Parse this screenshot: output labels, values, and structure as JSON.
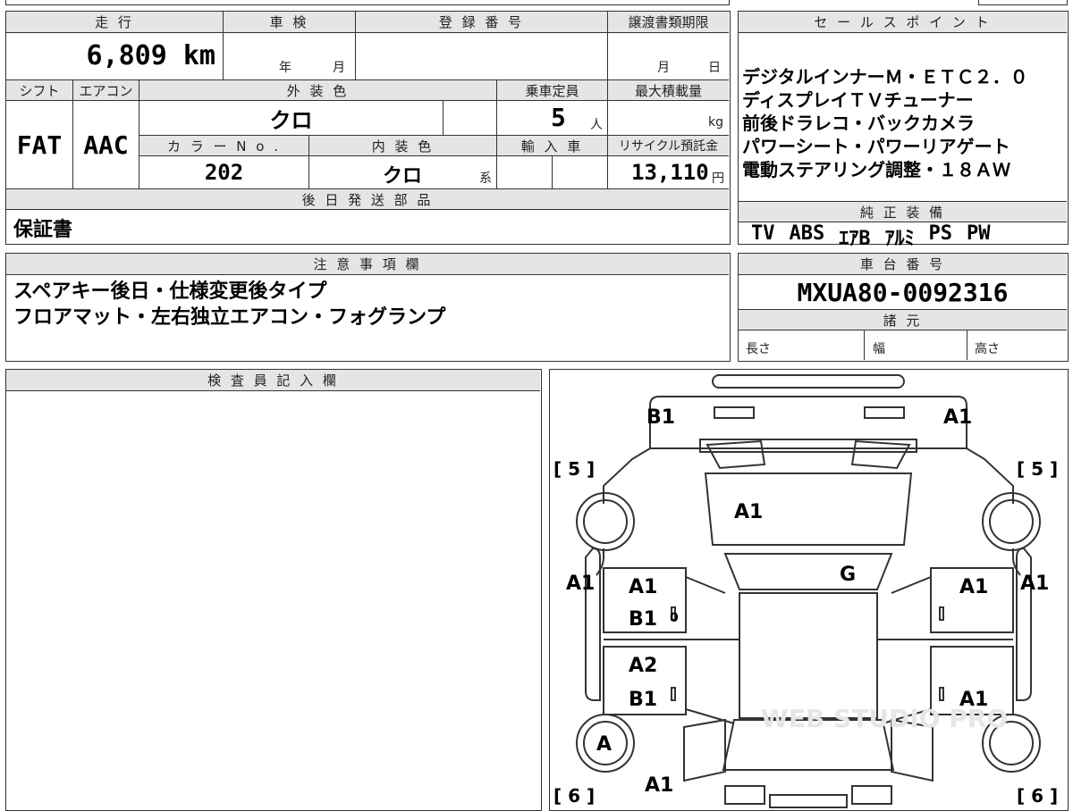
{
  "vehicle": {
    "headers": {
      "mileage": "走 行",
      "inspection": "車 検",
      "registration": "登 録 番 号",
      "transfer": "譲渡書類期限",
      "shift": "シフト",
      "aircon": "エアコン",
      "exterior_color": "外 装 色",
      "capacity": "乗車定員",
      "max_load": "最大積載量",
      "color_no": "カ ラ ー N o .",
      "interior_color": "内 装 色",
      "import": "輸 入 車",
      "recycle": "リサイクル預託金",
      "later_parts": "後 日 発 送 部 品"
    },
    "mileage": "6,809 km",
    "inspection_year_unit": "年",
    "inspection_month_unit": "月",
    "transfer_month_unit": "月",
    "transfer_day_unit": "日",
    "shift": "FAT",
    "aircon": "AAC",
    "exterior_color": "クロ",
    "capacity": "5",
    "capacity_unit": "人",
    "max_load_unit": "kg",
    "color_no": "202",
    "interior_color": "クロ",
    "interior_suffix": "系",
    "recycle_fee": "13,110",
    "recycle_unit": "円",
    "later_parts": "保証書"
  },
  "sales_points": {
    "header": "セ ー ル ス ポ イ ン ト",
    "lines": [
      "デジタルインナーＭ・ＥＴＣ２．０",
      "ディスプレイＴＶチューナー",
      "前後ドラレコ・バックカメラ",
      "パワーシート・パワーリアゲート",
      "電動ステアリング調整・１８ＡＷ"
    ]
  },
  "equipment": {
    "header": "純 正 装 備",
    "items": [
      "TV",
      "ABS",
      "ｴｱB",
      "ｱﾙﾐ",
      "PS",
      "PW"
    ]
  },
  "notes": {
    "header": "注 意 事 項 欄",
    "lines": [
      "スペアキー後日・仕様変更後タイプ",
      "フロアマット・左右独立エアコン・フォグランプ"
    ]
  },
  "chassis": {
    "header": "車 台 番 号",
    "number": "MXUA80-0092316"
  },
  "specs": {
    "header": "諸 元",
    "length": "長さ",
    "width": "幅",
    "height": "高さ"
  },
  "inspector": {
    "header": "検 査 員 記 入 欄"
  },
  "diagram": {
    "tire_fl": "[ 5 ]",
    "tire_fr": "[ 5 ]",
    "tire_rl": "[ 6 ]",
    "tire_rr": "[ 6 ]",
    "front_left_corner": "B1",
    "front_right_corner": "A1",
    "hood": "A1",
    "windshield": "G",
    "left_fender": "A1",
    "right_fender": "A1",
    "front_left_door_a": "A1",
    "front_left_door_b": "B1",
    "front_right_door": "A1",
    "rear_left_door_a": "A2",
    "rear_left_door_b": "B1",
    "rear_right_door": "A1",
    "rear_left_wheel": "A",
    "rear_left_quarter": "A1",
    "mark_zero": "0",
    "watermark": "WEB STUDIO PRO"
  }
}
